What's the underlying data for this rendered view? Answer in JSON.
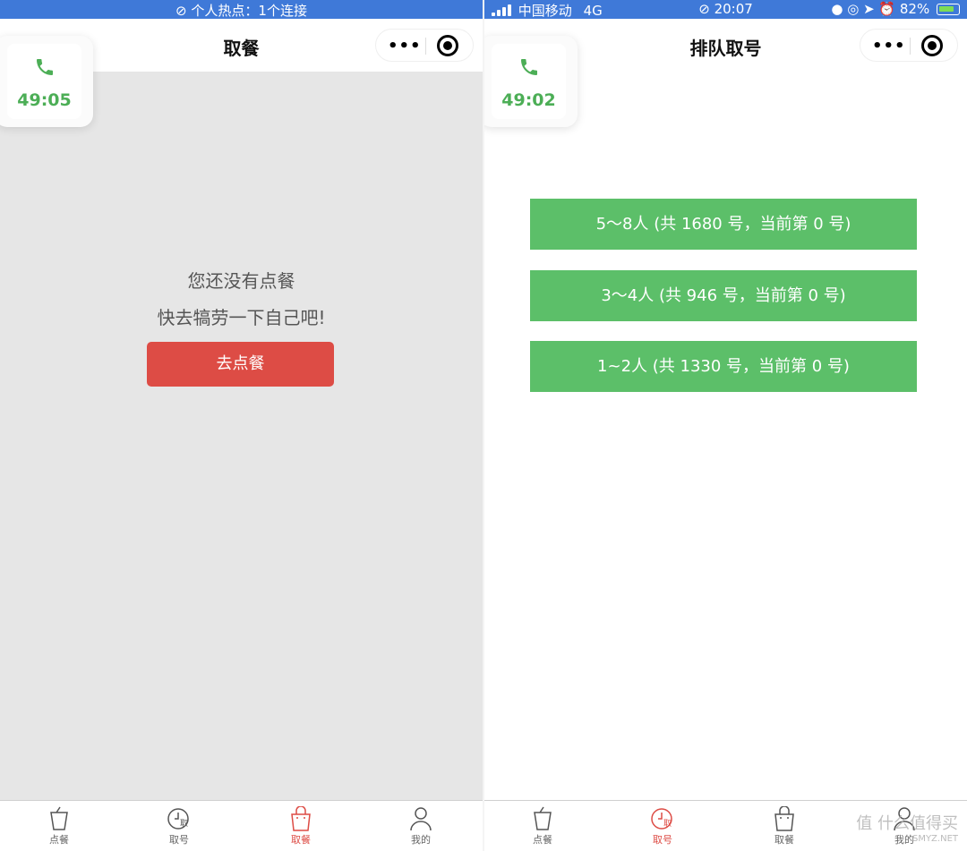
{
  "left": {
    "statusbar": {
      "hotspot": "个人热点：1个连接"
    },
    "nav_title": "取餐",
    "call_timer": "49:05",
    "empty_line1": "您还没有点餐",
    "empty_line2": "快去犒劳一下自己吧!",
    "order_button": "去点餐",
    "tabs": [
      {
        "label": "点餐",
        "icon": "cup-icon"
      },
      {
        "label": "取号",
        "icon": "clock-ticket-icon"
      },
      {
        "label": "取餐",
        "icon": "bag-icon",
        "active": true
      },
      {
        "label": "我的",
        "icon": "user-icon"
      }
    ]
  },
  "right": {
    "statusbar": {
      "carrier": "中国移动",
      "network": "4G",
      "time": "20:07",
      "battery": "82%"
    },
    "nav_title": "排队取号",
    "call_timer": "49:02",
    "queue_options": [
      "5～8人 (共 1680 号，当前第 0 号)",
      "3～4人 (共 946 号，当前第 0 号)",
      "1~2人 (共 1330 号，当前第 0 号)"
    ],
    "tabs": [
      {
        "label": "点餐",
        "icon": "cup-icon"
      },
      {
        "label": "取号",
        "icon": "clock-ticket-icon",
        "active": true
      },
      {
        "label": "取餐",
        "icon": "bag-icon"
      },
      {
        "label": "我的",
        "icon": "user-icon"
      }
    ]
  },
  "watermark": {
    "main": "值 什么值得买",
    "sub": "SMYZ.NET"
  },
  "colors": {
    "statusbar": "#3f79d8",
    "green": "#5cbf69",
    "red": "#dd4c45",
    "timer_green": "#4cae56"
  }
}
